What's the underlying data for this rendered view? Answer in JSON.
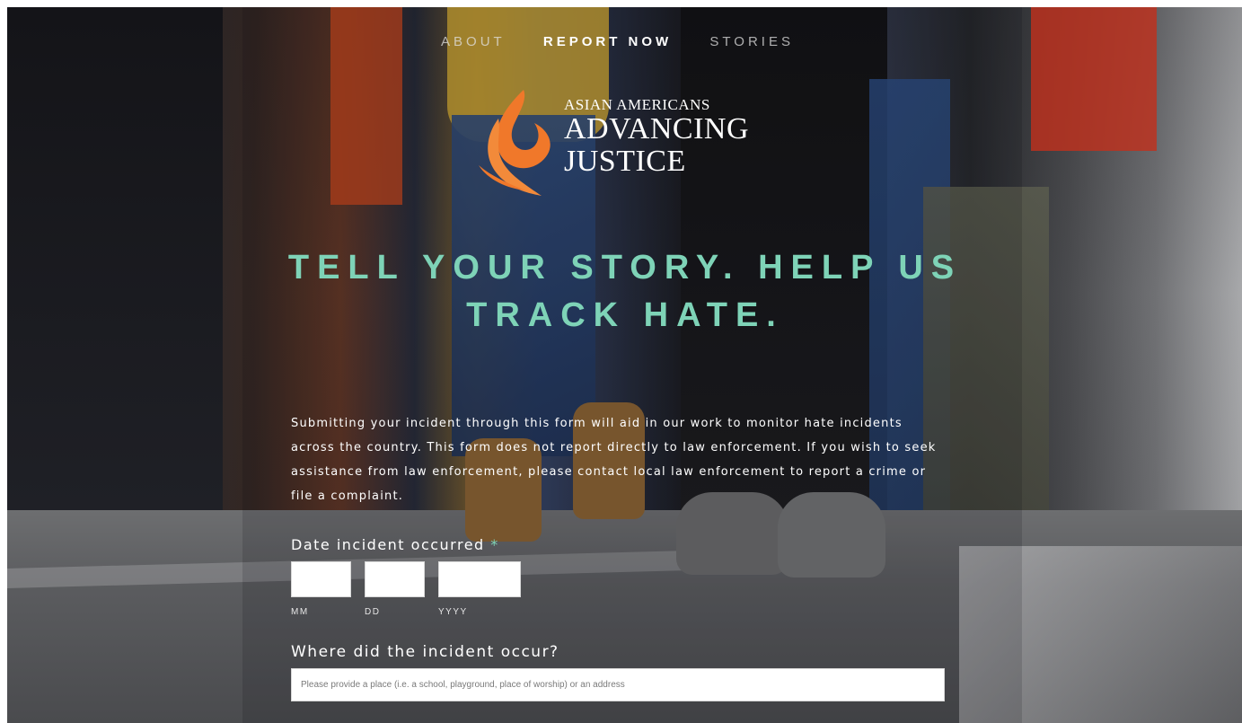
{
  "nav": {
    "items": [
      {
        "label": "ABOUT",
        "active": false
      },
      {
        "label": "REPORT NOW",
        "active": true
      },
      {
        "label": "STORIES",
        "active": false
      }
    ]
  },
  "logo": {
    "line1": "ASIAN AMERICANS",
    "line2": "ADVANCING",
    "line3": "JUSTICE",
    "flame_color": "#f0782a"
  },
  "hero": {
    "headline_line1": "TELL YOUR STORY. HELP US",
    "headline_line2": "TRACK HATE."
  },
  "intro": {
    "text": "Submitting your incident through this form will aid in our work to monitor hate incidents across the country. This form does not report directly to law enforcement. If you wish to seek assistance from law enforcement, please contact local law enforcement to report a crime or file a complaint."
  },
  "date_field": {
    "label": "Date incident occurred",
    "required_mark": "*",
    "month_value": "",
    "day_value": "",
    "year_value": "",
    "month_hint": "MM",
    "day_hint": "DD",
    "year_hint": "YYYY"
  },
  "location_field": {
    "label": "Where did the incident occur?",
    "value": "",
    "placeholder": "Please provide a place (i.e. a school, playground, place of worship) or an address"
  },
  "colors": {
    "accent": "#7ed3b7",
    "nav_active": "#ffffff",
    "nav_inactive": "#e1e1e1"
  }
}
